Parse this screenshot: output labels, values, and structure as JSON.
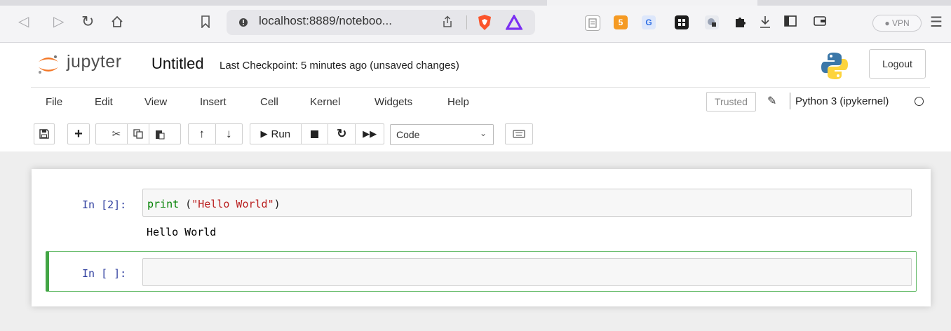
{
  "browser": {
    "url": "localhost:8889/noteboo...",
    "vpn_label": "● VPN"
  },
  "jupyter": {
    "logo_text": "jupyter",
    "notebook_title": "Untitled",
    "checkpoint_text": "Last Checkpoint: 5 minutes ago  (unsaved changes)",
    "logout_label": "Logout"
  },
  "menubar": {
    "items": [
      "File",
      "Edit",
      "View",
      "Insert",
      "Cell",
      "Kernel",
      "Widgets",
      "Help"
    ],
    "trusted_label": "Trusted",
    "kernel_name": "Python 3 (ipykernel)"
  },
  "toolbar": {
    "run_label": "Run",
    "cell_type": "Code"
  },
  "cells": [
    {
      "prompt": "In [2]:",
      "code_keyword": "print",
      "code_rest_open": " (",
      "code_string": "\"Hello World\"",
      "code_rest_close": ")",
      "output": "Hello World"
    },
    {
      "prompt": "In [ ]:",
      "code": ""
    }
  ],
  "colors": {
    "prompt_in": "#303f9f",
    "keyword": "#008000",
    "string": "#ba2121",
    "selected_cell_border": "#42a545",
    "jupyter_orange": "#f37726"
  }
}
